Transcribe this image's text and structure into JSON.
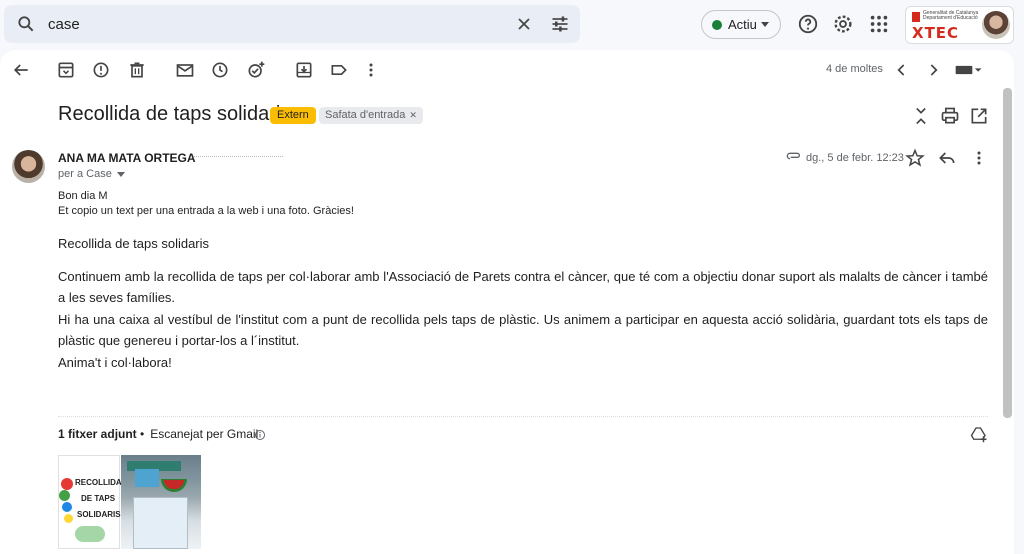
{
  "search": {
    "query": "case"
  },
  "status": {
    "label": "Actiu",
    "color": "#188038"
  },
  "brand": {
    "name": "XTEC",
    "org_line1": "Generalitat de Catalunya",
    "org_line2": "Departament d'Educació"
  },
  "toolbar": {
    "icons": [
      "back-icon",
      "archive-icon",
      "report-spam-icon",
      "delete-icon",
      "mark-unread-icon",
      "snooze-icon",
      "add-task-icon",
      "move-to-icon",
      "label-icon",
      "more-icon"
    ],
    "pager": "4 de moltes"
  },
  "email": {
    "subject": "Recollida de taps solidaris",
    "labels": {
      "external": "Extern",
      "inbox": "Safata d'entrada"
    },
    "sender": "ANA MA MATA ORTEGA",
    "to": "per a Case",
    "date": "dg., 5 de febr. 12:23",
    "greeting": "Bon dia M",
    "intro": "Et copio un text per una entrada a la web i una foto. Gràcies!",
    "body_title": "Recollida de taps solidaris",
    "paragraphs": [
      "Continuem amb la recollida de taps per col·laborar amb l'Associació de Parets contra el càncer, que té com a objectiu donar suport als malalts de càncer i també a les seves famílies.",
      "Hi ha una caixa al vestíbul de l'institut com a punt de recollida pels taps de plàstic. Us animem a participar en aquesta acció solidària, guardant tots els taps de plàstic que genereu i portar-los a l´institut.",
      "Anima't i col·labora!"
    ]
  },
  "attachments": {
    "count_label": "1 fitxer adjunt",
    "scan_label": "Escanejat per Gmail",
    "bullet": "•",
    "thumb_text": [
      "RECOLLIDA",
      "DE TAPS",
      "SOLIDARIS!"
    ]
  },
  "colors": {
    "accent_extern": "#fbbc04",
    "brand_red": "#d52b1e"
  }
}
